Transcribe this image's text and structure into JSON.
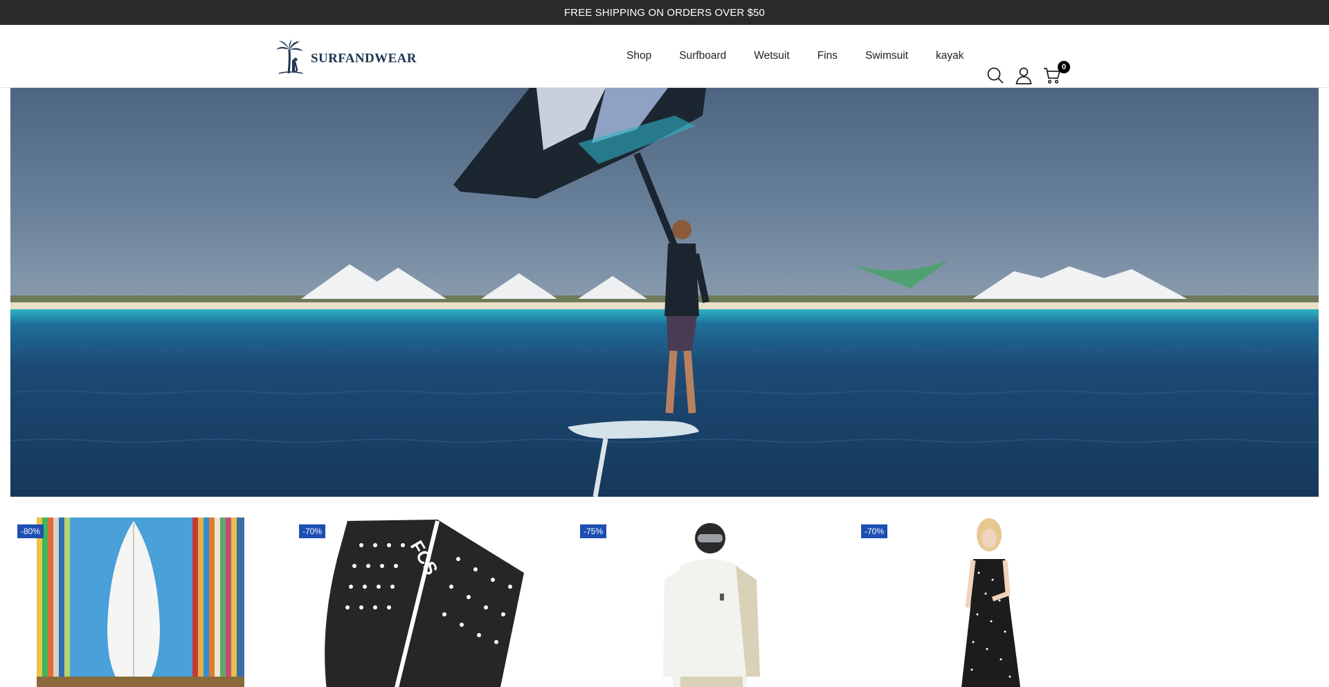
{
  "announcement": "FREE SHIPPING ON ORDERS OVER $50",
  "brand": {
    "name": "SURFANDWEAR",
    "logo_icon": "palm-tree-surfer-icon",
    "color": "#1d3550"
  },
  "nav": {
    "items": [
      {
        "label": "Shop"
      },
      {
        "label": "Surfboard"
      },
      {
        "label": "Wetsuit"
      },
      {
        "label": "Fins"
      },
      {
        "label": "Swimsuit"
      },
      {
        "label": "kayak"
      }
    ]
  },
  "header_icons": {
    "search": "search-icon",
    "account": "user-icon",
    "cart": "cart-icon",
    "cart_count": "0"
  },
  "hero": {
    "image": "wing-foil rider over turquoise sea with white salt mountains",
    "colors": {
      "sky": "#5e7590",
      "sea": "#1f4a73",
      "accent": "#2fb3c4"
    }
  },
  "products": [
    {
      "discount": "-80%",
      "image": "surfboard-photo"
    },
    {
      "discount": "-70%",
      "image": "fcs-traction-pad-photo"
    },
    {
      "discount": "-75%",
      "image": "snow-jacket-photo"
    },
    {
      "discount": "-70%",
      "image": "black-dress-photo"
    }
  ],
  "colors": {
    "announcement_bg": "#2a2a2a",
    "badge_bg": "#1d4fb3"
  }
}
